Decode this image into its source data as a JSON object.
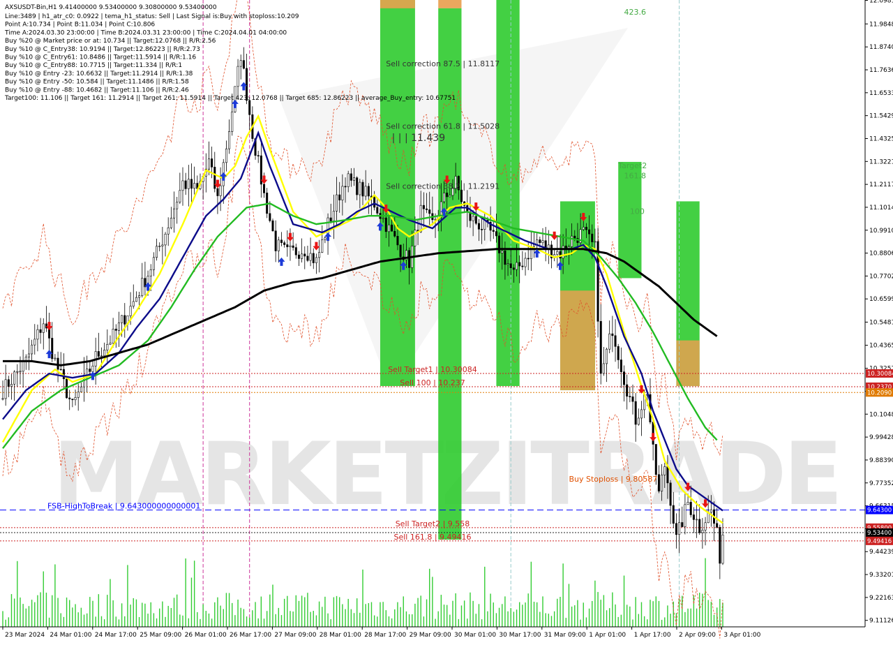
{
  "chart_data": {
    "type": "candlestick",
    "symbol_line": "AXSUSDT-Bin,H1  9.41400000 9.53400000 9.30800000 9.53400000",
    "info_lines": [
      "Line:3489  |  h1_atr_c0: 0.0922  |  tema_h1_status: Sell  |  Last Signal is:Buy with stoploss:10.209",
      "Point A:10.734  |  Point B:11.034  |  Point C:10.806",
      "Time A:2024.03.30 23:00:00  |  Time B:2024.03.31 23:00:00  |  Time C:2024.04.01 04:00:00",
      "Buy %20 @ Market price or at: 10.734  ||  Target:12.0768  ||  R/R:2.56",
      "Buy %10 @ C_Entry38: 10.9194  ||  Target:12.86223  ||  R/R:2.73",
      "Buy %10 @ C_Entry61: 10.8486  ||  Target:11.5914  ||  R/R:1.16",
      "Buy %10 @ C_Entry88: 10.7715  ||  Target:11.334  ||  R/R:1",
      "Buy %10 @ Entry -23: 10.6632  ||  Target:11.2914  ||  R/R:1.38",
      "Buy %10 @ Entry -50: 10.584  ||  Target:11.1486  ||  R/R:1.58",
      "Buy %10 @ Entry -88: 10.4682  ||  Target:11.106  ||  R/R:2.46",
      "Target100: 11.106  ||  Target 161: 11.2914  ||  Target 261: 11.5914  ||  Target 423: 12.0768  ||  Target 685: 12.86223  ||  average_Buy_entry: 10.67751"
    ],
    "y_range": [
      9.08,
      12.1
    ],
    "y_ticks": [
      "12.0981",
      "11.9848",
      "11.8740",
      "11.7636",
      "11.6533",
      "11.5429",
      "11.4325",
      "11.3221",
      "11.2117",
      "11.1014",
      "10.9910",
      "10.8806",
      "10.7702",
      "10.6599",
      "10.5481",
      "10.4365",
      "10.3257",
      "10.2145",
      "10.1048",
      "9.99428",
      "9.88390",
      "9.77352",
      "9.66315",
      "9.55277",
      "9.44239",
      "9.33201",
      "9.22163",
      "9.11126"
    ],
    "x_labels": [
      "23 Mar 2024",
      "24 Mar 01:00",
      "24 Mar 17:00",
      "25 Mar 09:00",
      "26 Mar 01:00",
      "26 Mar 17:00",
      "27 Mar 09:00",
      "28 Mar 01:00",
      "28 Mar 17:00",
      "29 Mar 09:00",
      "30 Mar 01:00",
      "30 Mar 17:00",
      "31 Mar 09:00",
      "1 Apr 01:00",
      "1 Apr 17:00",
      "2 Apr 09:00",
      "3 Apr 01:00"
    ],
    "bar_count": 249,
    "close_anchors": [
      [
        0,
        10.22
      ],
      [
        8,
        10.36
      ],
      [
        14,
        10.55
      ],
      [
        18,
        10.36
      ],
      [
        24,
        10.14
      ],
      [
        32,
        10.38
      ],
      [
        38,
        10.48
      ],
      [
        44,
        10.62
      ],
      [
        50,
        10.78
      ],
      [
        56,
        10.98
      ],
      [
        62,
        11.22
      ],
      [
        67,
        11.18
      ],
      [
        71,
        11.32
      ],
      [
        74,
        11.14
      ],
      [
        78,
        11.48
      ],
      [
        82,
        11.84
      ],
      [
        86,
        11.46
      ],
      [
        90,
        11.16
      ],
      [
        94,
        10.92
      ],
      [
        98,
        10.88
      ],
      [
        104,
        10.9
      ],
      [
        108,
        10.84
      ],
      [
        112,
        11.02
      ],
      [
        118,
        11.24
      ],
      [
        124,
        11.18
      ],
      [
        128,
        11.12
      ],
      [
        132,
        11.02
      ],
      [
        136,
        10.92
      ],
      [
        140,
        10.84
      ],
      [
        144,
        11.08
      ],
      [
        148,
        11.02
      ],
      [
        152,
        11.14
      ],
      [
        156,
        11.22
      ],
      [
        160,
        11.06
      ],
      [
        164,
        11.02
      ],
      [
        168,
        10.98
      ],
      [
        172,
        10.88
      ],
      [
        176,
        10.78
      ],
      [
        180,
        10.86
      ],
      [
        184,
        10.94
      ],
      [
        188,
        10.9
      ],
      [
        192,
        10.88
      ],
      [
        196,
        10.95
      ],
      [
        200,
        10.98
      ],
      [
        204,
        10.9
      ],
      [
        206,
        10.28
      ],
      [
        210,
        10.52
      ],
      [
        214,
        10.28
      ],
      [
        218,
        10.08
      ],
      [
        222,
        10.22
      ],
      [
        224,
        9.92
      ],
      [
        226,
        9.72
      ],
      [
        228,
        9.86
      ],
      [
        230,
        9.7
      ],
      [
        232,
        9.5
      ],
      [
        236,
        9.68
      ],
      [
        240,
        9.56
      ],
      [
        244,
        9.64
      ],
      [
        246,
        9.52
      ],
      [
        247,
        9.42
      ],
      [
        248,
        9.53
      ]
    ],
    "mas": [
      {
        "name": "tema",
        "color": "#ffff00",
        "anchors": [
          [
            0,
            9.97
          ],
          [
            10,
            10.22
          ],
          [
            18,
            10.32
          ],
          [
            24,
            10.26
          ],
          [
            32,
            10.3
          ],
          [
            40,
            10.48
          ],
          [
            46,
            10.6
          ],
          [
            54,
            10.78
          ],
          [
            62,
            11.02
          ],
          [
            70,
            11.28
          ],
          [
            76,
            11.24
          ],
          [
            80,
            11.3
          ],
          [
            84,
            11.44
          ],
          [
            88,
            11.54
          ],
          [
            92,
            11.38
          ],
          [
            100,
            11.08
          ],
          [
            108,
            10.96
          ],
          [
            114,
            11.0
          ],
          [
            120,
            11.04
          ],
          [
            128,
            11.16
          ],
          [
            132,
            11.1
          ],
          [
            136,
            11.0
          ],
          [
            140,
            10.96
          ],
          [
            148,
            11.02
          ],
          [
            154,
            11.1
          ],
          [
            160,
            11.12
          ],
          [
            168,
            11.06
          ],
          [
            172,
            11.0
          ],
          [
            176,
            10.94
          ],
          [
            184,
            10.9
          ],
          [
            190,
            10.86
          ],
          [
            196,
            10.88
          ],
          [
            200,
            10.92
          ],
          [
            204,
            10.9
          ],
          [
            208,
            10.78
          ],
          [
            214,
            10.5
          ],
          [
            220,
            10.24
          ],
          [
            224,
            10.08
          ],
          [
            228,
            9.88
          ],
          [
            234,
            9.74
          ],
          [
            240,
            9.66
          ],
          [
            244,
            9.62
          ],
          [
            248,
            9.58
          ]
        ]
      },
      {
        "name": "ema-fast",
        "color": "#0c0c8a",
        "anchors": [
          [
            0,
            10.08
          ],
          [
            8,
            10.22
          ],
          [
            16,
            10.3
          ],
          [
            24,
            10.28
          ],
          [
            32,
            10.3
          ],
          [
            40,
            10.4
          ],
          [
            46,
            10.52
          ],
          [
            54,
            10.66
          ],
          [
            62,
            10.86
          ],
          [
            70,
            11.06
          ],
          [
            76,
            11.14
          ],
          [
            82,
            11.24
          ],
          [
            88,
            11.46
          ],
          [
            92,
            11.3
          ],
          [
            100,
            11.02
          ],
          [
            110,
            10.98
          ],
          [
            116,
            11.02
          ],
          [
            122,
            11.08
          ],
          [
            128,
            11.12
          ],
          [
            134,
            11.08
          ],
          [
            140,
            11.04
          ],
          [
            148,
            11.0
          ],
          [
            156,
            11.1
          ],
          [
            160,
            11.1
          ],
          [
            168,
            11.02
          ],
          [
            174,
            10.98
          ],
          [
            180,
            10.94
          ],
          [
            188,
            10.9
          ],
          [
            196,
            10.9
          ],
          [
            200,
            10.92
          ],
          [
            204,
            10.86
          ],
          [
            208,
            10.72
          ],
          [
            214,
            10.48
          ],
          [
            220,
            10.3
          ],
          [
            224,
            10.12
          ],
          [
            228,
            9.98
          ],
          [
            232,
            9.84
          ],
          [
            236,
            9.76
          ],
          [
            240,
            9.72
          ],
          [
            244,
            9.68
          ],
          [
            248,
            9.64
          ]
        ]
      },
      {
        "name": "ema-mid",
        "color": "#22bb22",
        "anchors": [
          [
            0,
            9.94
          ],
          [
            10,
            10.12
          ],
          [
            20,
            10.22
          ],
          [
            30,
            10.28
          ],
          [
            40,
            10.34
          ],
          [
            50,
            10.46
          ],
          [
            58,
            10.62
          ],
          [
            66,
            10.8
          ],
          [
            74,
            10.96
          ],
          [
            84,
            11.1
          ],
          [
            92,
            11.12
          ],
          [
            100,
            11.06
          ],
          [
            108,
            11.02
          ],
          [
            118,
            11.04
          ],
          [
            126,
            11.06
          ],
          [
            134,
            11.06
          ],
          [
            142,
            11.04
          ],
          [
            150,
            11.06
          ],
          [
            160,
            11.08
          ],
          [
            168,
            11.04
          ],
          [
            176,
            11.0
          ],
          [
            184,
            10.98
          ],
          [
            192,
            10.96
          ],
          [
            200,
            10.94
          ],
          [
            206,
            10.86
          ],
          [
            212,
            10.76
          ],
          [
            218,
            10.64
          ],
          [
            224,
            10.5
          ],
          [
            230,
            10.34
          ],
          [
            236,
            10.18
          ],
          [
            242,
            10.04
          ],
          [
            246,
            9.98
          ]
        ]
      },
      {
        "name": "ema-slow",
        "color": "#000000",
        "anchors": [
          [
            0,
            10.36
          ],
          [
            10,
            10.36
          ],
          [
            20,
            10.34
          ],
          [
            30,
            10.36
          ],
          [
            40,
            10.4
          ],
          [
            50,
            10.44
          ],
          [
            60,
            10.5
          ],
          [
            70,
            10.56
          ],
          [
            80,
            10.62
          ],
          [
            90,
            10.7
          ],
          [
            100,
            10.74
          ],
          [
            110,
            10.76
          ],
          [
            120,
            10.8
          ],
          [
            130,
            10.84
          ],
          [
            140,
            10.86
          ],
          [
            150,
            10.88
          ],
          [
            160,
            10.89
          ],
          [
            170,
            10.9
          ],
          [
            180,
            10.9
          ],
          [
            190,
            10.9
          ],
          [
            200,
            10.9
          ],
          [
            208,
            10.88
          ],
          [
            214,
            10.84
          ],
          [
            220,
            10.78
          ],
          [
            226,
            10.72
          ],
          [
            232,
            10.64
          ],
          [
            238,
            10.56
          ],
          [
            246,
            10.48
          ]
        ]
      }
    ],
    "zones": [
      {
        "b0": 130,
        "b1": 142,
        "top": 12.1,
        "bottom": 10.24,
        "color": "#33cc33"
      },
      {
        "b0": 150,
        "b1": 158,
        "top": 12.1,
        "bottom": 12.06,
        "color": "#e8a050"
      },
      {
        "b0": 150,
        "b1": 158,
        "top": 12.06,
        "bottom": 9.5,
        "color": "#33cc33"
      },
      {
        "b0": 170,
        "b1": 178,
        "top": 12.1,
        "bottom": 10.24,
        "color": "#33cc33"
      },
      {
        "b0": 192,
        "b1": 204,
        "top": 11.13,
        "bottom": 10.22,
        "color": "#33cc33"
      },
      {
        "b0": 212,
        "b1": 220,
        "top": 11.32,
        "bottom": 10.76,
        "color": "#33cc33"
      },
      {
        "b0": 232,
        "b1": 240,
        "top": 11.13,
        "bottom": 10.24,
        "color": "#33cc33"
      }
    ],
    "zone_overlays": [
      {
        "b0": 130,
        "b1": 142,
        "top": 12.1,
        "bottom": 12.06,
        "color": "#f0a050"
      },
      {
        "b0": 192,
        "b1": 204,
        "top": 10.7,
        "bottom": 10.22,
        "color": "#e8a050"
      },
      {
        "b0": 232,
        "b1": 240,
        "top": 10.46,
        "bottom": 10.24,
        "color": "#e8a050"
      }
    ],
    "hlines": [
      {
        "value": 10.30084,
        "color": "#cc2222",
        "style": "dotted",
        "label": "Sell Target1 | 10.30084",
        "axis_label": "10.30084",
        "label_color": "#cc2222"
      },
      {
        "value": 10.237,
        "color": "#cc2222",
        "style": "dotted",
        "label": "Sell 100 | 10.237",
        "axis_label": "10.2370",
        "label_color": "#cc2222"
      },
      {
        "value": 10.209,
        "color": "#e07a00",
        "style": "dotted",
        "label": "",
        "axis_label": "10.2090",
        "label_color": "#e07a00"
      },
      {
        "value": 9.643,
        "color": "#0000ff",
        "style": "dashed",
        "label": "FSB-HighToBreak | 9.643000000000001",
        "axis_label": "9.64300",
        "label_color": "#0000ff"
      },
      {
        "value": 9.558,
        "color": "#cc2222",
        "style": "dotted",
        "label": "Sell Target2 | 9.558",
        "axis_label": "9.55800",
        "label_color": "#cc2222"
      },
      {
        "value": 9.534,
        "color": "#222222",
        "style": "dotted",
        "label": "",
        "axis_label": "9.53400",
        "label_color": "#000000"
      },
      {
        "value": 9.49416,
        "color": "#cc2222",
        "style": "dotted",
        "label": "Sell 161.8 | 9.49416",
        "axis_label": "9.49416",
        "label_color": "#cc2222"
      }
    ],
    "annotations": [
      {
        "text": "Sell correction 87.5 | 11.8117",
        "bar": 132,
        "value": 11.78,
        "color": "#333333"
      },
      {
        "text": "| | | 11.439",
        "bar": 134,
        "value": 11.42,
        "color": "#333333"
      },
      {
        "text": "Sell correction 61.8 | 11.5028",
        "bar": 132,
        "value": 11.48,
        "color": "#333333"
      },
      {
        "text": "Sell correction 38.2 | 11.2191",
        "bar": 132,
        "value": 11.19,
        "color": "#333333"
      },
      {
        "text": "423.6",
        "bar": 214,
        "value": 12.03,
        "color": "#44aa44"
      },
      {
        "text": "Target2",
        "bar": 212,
        "value": 11.29,
        "color": "#44aa44"
      },
      {
        "text": "161.8",
        "bar": 214,
        "value": 11.24,
        "color": "#44aa44"
      },
      {
        "text": "100",
        "bar": 216,
        "value": 11.07,
        "color": "#44aa44"
      },
      {
        "text": "Buy Stoploss | 9.80587",
        "bar": 195,
        "value": 9.78,
        "color": "#e05000"
      }
    ],
    "watermark": "MARKETZITRADE",
    "vlines": [
      {
        "bar": 69,
        "color": "#cc3399"
      },
      {
        "bar": 85,
        "color": "#cc3399"
      },
      {
        "bar": 175,
        "color": "#99cccc"
      },
      {
        "bar": 233,
        "color": "#99cccc"
      }
    ]
  }
}
